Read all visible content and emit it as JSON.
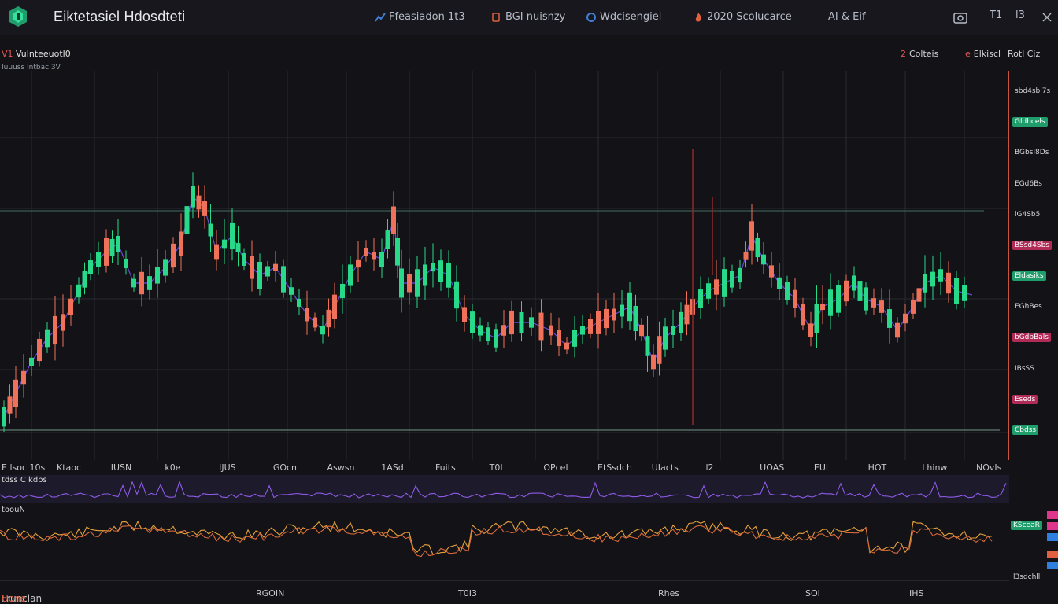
{
  "app": {
    "title": "Eiktetasiel Hdosdteti"
  },
  "nav": [
    {
      "label": "Ffeasiadon 1t3",
      "icon": "chart-icon",
      "color": "#3f7fd8"
    },
    {
      "label": "BGI nuisnzy",
      "icon": "copy-icon",
      "color": "#e06040"
    },
    {
      "label": "Wdcisengiel",
      "icon": "gauge-icon",
      "color": "#3f7fd8"
    },
    {
      "label": "2020 Scolucarce",
      "icon": "fire-icon",
      "color": "#e06040"
    },
    {
      "label": "AI & Eif",
      "icon": "",
      "color": ""
    }
  ],
  "top_right": {
    "time": "T1",
    "label": "l3"
  },
  "symbol": {
    "name": "Vulnteeuotl0",
    "prefix": "V1",
    "sub": "Iuuuss Intbac 3V"
  },
  "legend": [
    {
      "label": "Colteis",
      "mark": "2"
    },
    {
      "label": "Elkiscl",
      "mark": "e"
    },
    {
      "label": "Rotl Ciz",
      "mark": ""
    }
  ],
  "price_scale": [
    {
      "label": "sbd4sbi7s",
      "style": "plain"
    },
    {
      "label": "Gldhcels",
      "style": "green"
    },
    {
      "label": "BGbsI8Ds",
      "style": "plain"
    },
    {
      "label": "EGd6Bs",
      "style": "plain"
    },
    {
      "label": "lG4Sb5",
      "style": "plain"
    },
    {
      "label": "BSsd4Sbs",
      "style": "pink"
    },
    {
      "label": "Eldasiks",
      "style": "green"
    },
    {
      "label": "EGhBes",
      "style": "plain"
    },
    {
      "label": "bGdbBals",
      "style": "pink"
    },
    {
      "label": "IBsSS",
      "style": "plain"
    },
    {
      "label": "Eseds",
      "style": "pink"
    },
    {
      "label": "Cbdss",
      "style": "green"
    }
  ],
  "time_axis": [
    "Ktaoc",
    "IUSN",
    "k0e",
    "IJUS",
    "GOcn",
    "Aswsn",
    "1ASd",
    "Fuits",
    "T0I",
    "OPcel",
    "EtSsdch",
    "UIacts",
    "l2",
    "UOAS",
    "EUI",
    "HOT",
    "Lhinw",
    "NOvIs"
  ],
  "time_axis_prefix": "E lsoc 10s",
  "indicator1": {
    "label": "tdss C kdbs"
  },
  "indicator2": {
    "label": "toouN"
  },
  "indicator_scale": [
    {
      "label": "KSceaR",
      "style": "green"
    },
    {
      "label": "l3sdchll",
      "style": "plain"
    }
  ],
  "bottom_axis": {
    "left_label": "Frunclan",
    "left_sub": "Uone",
    "labels": [
      "RGOIN",
      "T0I3",
      "Rhes",
      "SOI",
      "IHS"
    ]
  },
  "colors": {
    "up": "#28d98a",
    "down": "#f0715a",
    "grid": "#2a2a33",
    "background": "#121217",
    "ma": "#6b4bd8",
    "accent_red": "#c8553d"
  }
}
